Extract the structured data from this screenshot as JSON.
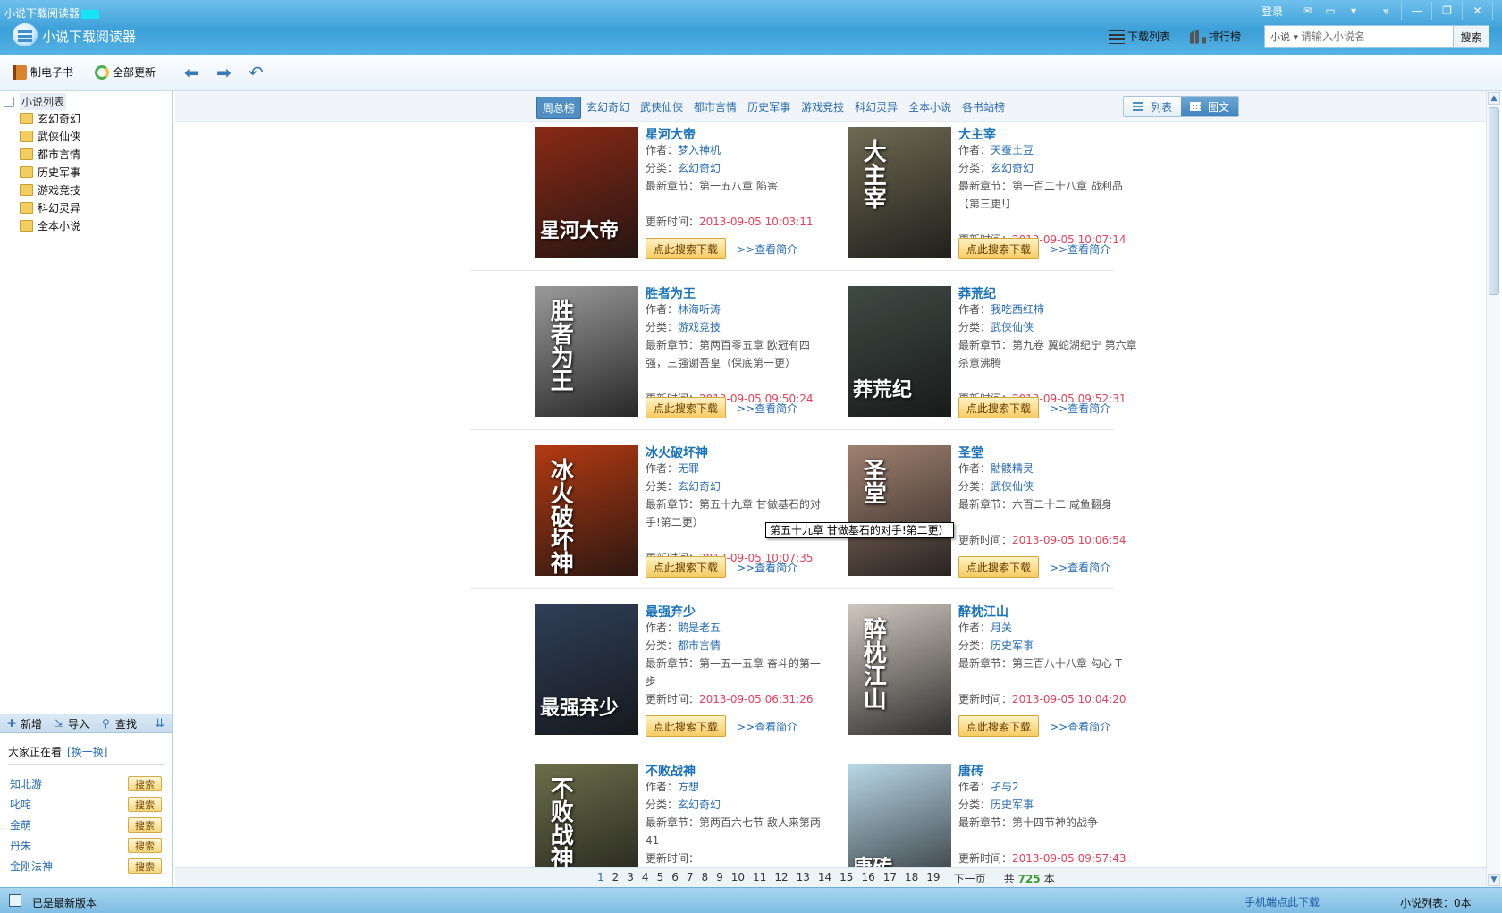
{
  "window": {
    "title": "小说下载阅读器",
    "app_name": "小说下载阅读器",
    "login": "登录"
  },
  "nav": {
    "download_list": "下载列表",
    "ranking": "排行榜"
  },
  "search": {
    "type": "小说",
    "placeholder": "请输入小说名",
    "button": "搜索"
  },
  "toolbar": {
    "make_ebook": "制电子书",
    "update_all": "全部更新"
  },
  "sidebar": {
    "root": "小说列表",
    "items": [
      "玄幻奇幻",
      "武侠仙侠",
      "都市言情",
      "历史军事",
      "游戏竞技",
      "科幻灵异",
      "全本小说"
    ],
    "actions": {
      "add": "新增",
      "import": "导入",
      "find": "查找"
    },
    "watching_label": "大家正在看",
    "swap": "[换一换]",
    "hot": [
      {
        "name": "知北游",
        "btn": "搜索"
      },
      {
        "name": "叱咤",
        "btn": "搜索"
      },
      {
        "name": "金萌",
        "btn": "搜索"
      },
      {
        "name": "丹朱",
        "btn": "搜索"
      },
      {
        "name": "金刚法神",
        "btn": "搜索"
      }
    ]
  },
  "tabs": [
    "周总榜",
    "玄幻奇幻",
    "武侠仙侠",
    "都市言情",
    "历史军事",
    "游戏竞技",
    "科幻灵异",
    "全本小说",
    "各书站榜"
  ],
  "view": {
    "list": "列表",
    "grid": "图文"
  },
  "labels": {
    "author": "作者：",
    "category": "分类：",
    "latest": "最新章节：",
    "updated": "更新时间：",
    "download": "点此搜索下载",
    "intro": ">>查看简介"
  },
  "books": [
    {
      "title": "星河大帝",
      "author": "梦入神机",
      "category": "玄幻奇幻",
      "latest": "第一五八章 陷害",
      "updated": "2013-09-05 10:03:11",
      "cover_text": "星河大帝",
      "cover_color": "#8a2a16"
    },
    {
      "title": "大主宰",
      "author": "天蚕土豆",
      "category": "玄幻奇幻",
      "latest": "第一百二十八章 战利品【第三更!】",
      "updated": "2013-09-05 10:07:14",
      "cover_text": "大主宰",
      "cover_color": "#6f6a52"
    },
    {
      "title": "胜者为王",
      "author": "林海听涛",
      "category": "游戏竞技",
      "latest": "第两百零五章 欧冠有四强，三强谢吾皇（保底第一更）",
      "updated": "2013-09-05 09:50:24",
      "cover_text": "胜者为王",
      "cover_color": "#9a9a9a"
    },
    {
      "title": "莽荒纪",
      "author": "我吃西红柿",
      "category": "武侠仙侠",
      "latest": "第九卷 翼蛇湖纪宁 第六章 杀意沸腾",
      "updated": "2013-09-05 09:52:31",
      "cover_text": "莽荒纪",
      "cover_color": "#3f4a45"
    },
    {
      "title": "冰火破坏神",
      "author": "无罪",
      "category": "玄幻奇幻",
      "latest": "第五十九章 甘做基石的对手!第二更）",
      "updated": "2013-09-05 10:07:35",
      "cover_text": "冰火破坏神",
      "cover_color": "#b33a12"
    },
    {
      "title": "圣堂",
      "author": "骷髅精灵",
      "category": "武侠仙侠",
      "latest": "六百二十二 咸鱼翻身",
      "updated": "2013-09-05 10:06:54",
      "cover_text": "圣堂",
      "cover_color": "#a08170"
    },
    {
      "title": "最强弃少",
      "author": "鹅是老五",
      "category": "都市言情",
      "latest": "第一五一五章 奋斗的第一步",
      "updated": "2013-09-05 06:31:26",
      "cover_text": "最强弃少",
      "cover_color": "#2f3f58"
    },
    {
      "title": "醉枕江山",
      "author": "月关",
      "category": "历史军事",
      "latest": "第三百八十八章 勾心 T",
      "updated": "2013-09-05 10:04:20",
      "cover_text": "醉枕江山",
      "cover_color": "#cfc7bf"
    },
    {
      "title": "不败战神",
      "author": "方想",
      "category": "玄幻奇幻",
      "latest": "第两百六七节 敌人来第两41",
      "updated": "",
      "cover_text": "不败战神",
      "cover_color": "#6b6f4a"
    },
    {
      "title": "唐砖",
      "author": "孑与2",
      "category": "历史军事",
      "latest": "第十四节神的战争",
      "updated": "2013-09-05 09:57:43",
      "cover_text": "唐砖",
      "cover_color": "#b9d8e8"
    }
  ],
  "tooltip": "第五十九章 甘做基石的对手!第二更）",
  "pager": {
    "pages": [
      "1",
      "2",
      "3",
      "4",
      "5",
      "6",
      "7",
      "8",
      "9",
      "10",
      "11",
      "12",
      "13",
      "14",
      "15",
      "16",
      "17",
      "18",
      "19"
    ],
    "current": "1",
    "next": "下一页",
    "total_prefix": "共",
    "total": "725",
    "total_suffix": "本"
  },
  "status": {
    "text": "已是最新版本",
    "mobile": "手机端点此下载",
    "count": "小说列表：0本"
  },
  "colors": {
    "title_bar": "#3b9fd8",
    "accent": "#2a6db1",
    "time": "#e4415a",
    "button": "#f6cc62"
  }
}
